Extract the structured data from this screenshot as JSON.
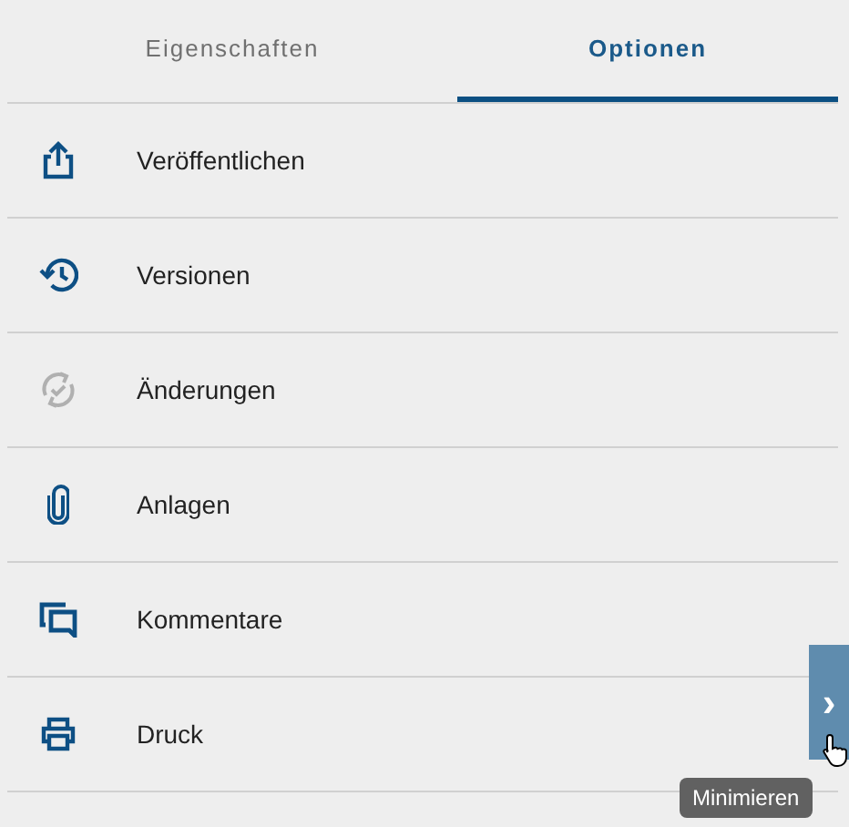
{
  "tabs": [
    {
      "label": "Eigenschaften",
      "selected": false
    },
    {
      "label": "Optionen",
      "selected": true
    }
  ],
  "items": [
    {
      "kind": "publish",
      "label": "Veröffentlichen",
      "disabled": false
    },
    {
      "kind": "history",
      "label": "Versionen",
      "disabled": false
    },
    {
      "kind": "changes",
      "label": "Änderungen",
      "disabled": true
    },
    {
      "kind": "attachment",
      "label": "Anlagen",
      "disabled": false
    },
    {
      "kind": "comments",
      "label": "Kommentare",
      "disabled": false
    },
    {
      "kind": "print",
      "label": "Druck",
      "disabled": false
    }
  ],
  "side_handle": {
    "icon": "›"
  },
  "tooltip": "Minimieren"
}
